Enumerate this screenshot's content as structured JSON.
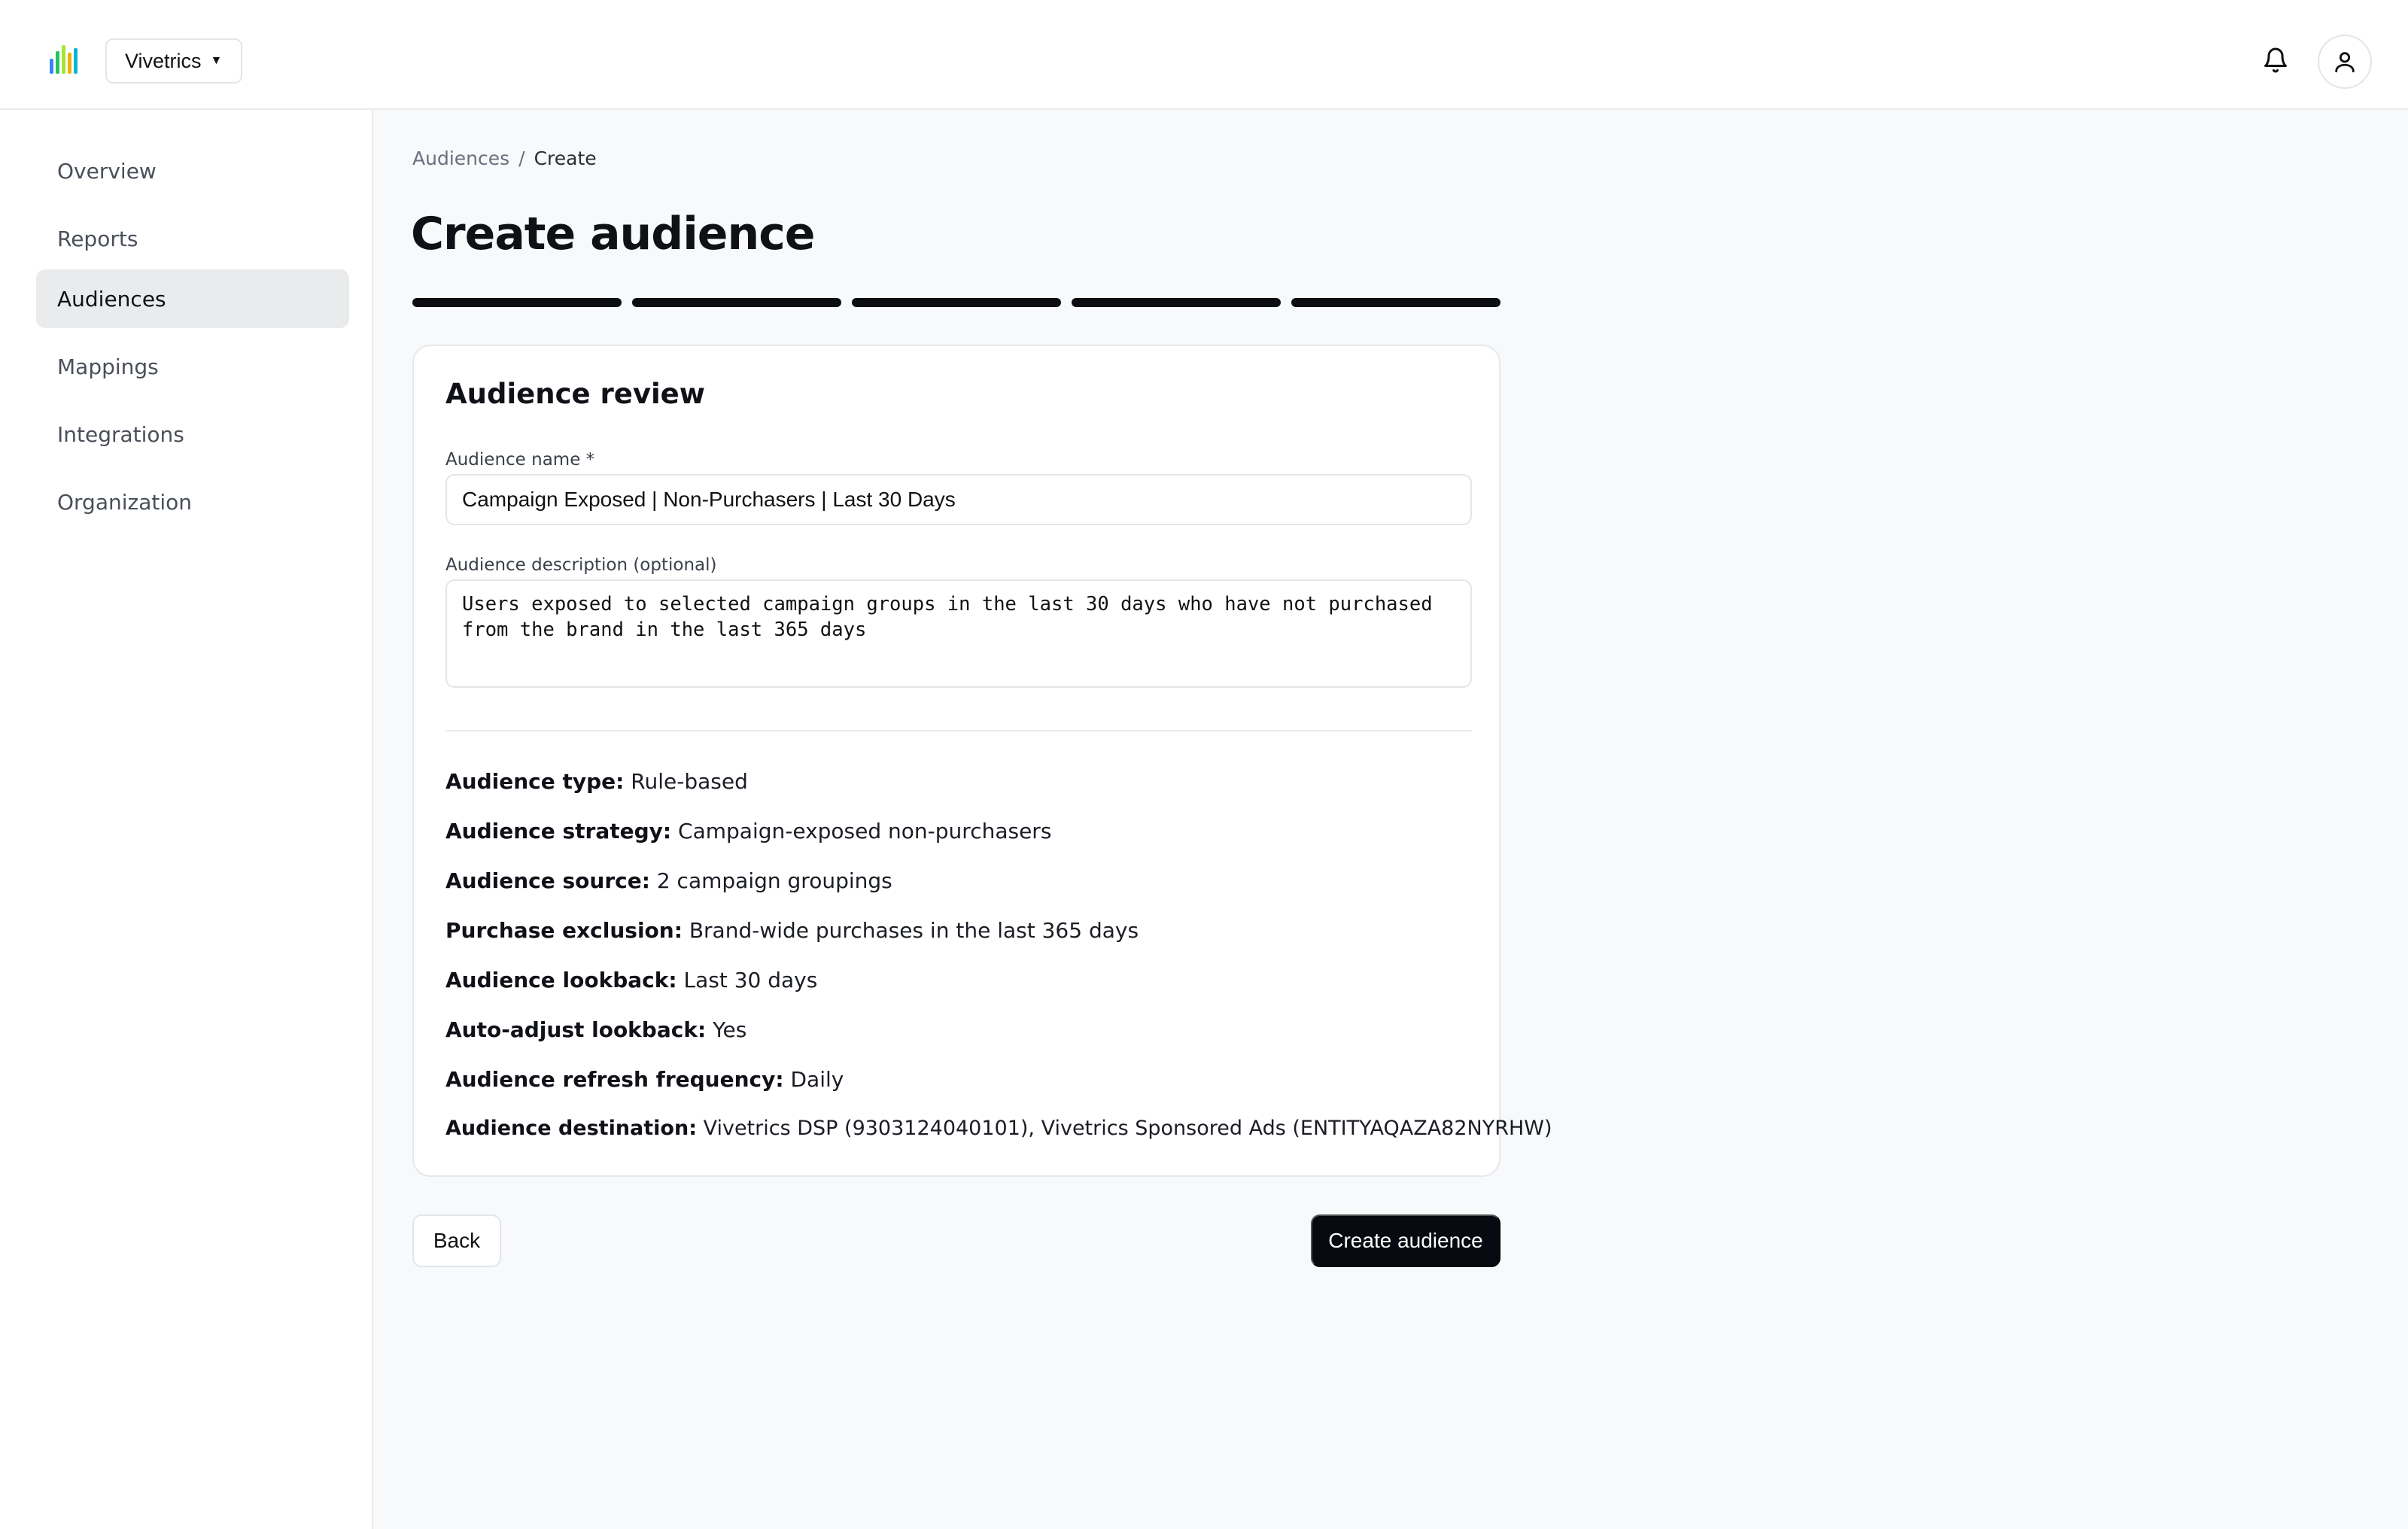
{
  "header": {
    "org_name": "Vivetrics",
    "logo_colors": [
      "#3b82f6",
      "#22c55e",
      "#a3e635",
      "#eab308",
      "#06b6d4"
    ]
  },
  "sidebar": {
    "items": [
      {
        "label": "Overview"
      },
      {
        "label": "Reports"
      },
      {
        "label": "Audiences",
        "active": true
      },
      {
        "label": "Mappings"
      },
      {
        "label": "Integrations"
      },
      {
        "label": "Organization"
      }
    ]
  },
  "breadcrumb": {
    "parent": "Audiences",
    "separator": "/",
    "current": "Create"
  },
  "page": {
    "title": "Create audience",
    "step_count": 5,
    "steps_completed": 5
  },
  "card": {
    "title": "Audience review",
    "name_label": "Audience name *",
    "name_value": "Campaign Exposed | Non-Purchasers | Last 30 Days",
    "description_label": "Audience description (optional)",
    "description_value": "Users exposed to selected campaign groups in the last 30 days who have not purchased from the brand in the last 365 days",
    "details": [
      {
        "label": "Audience type:",
        "value": "Rule-based"
      },
      {
        "label": "Audience strategy:",
        "value": "Campaign-exposed non-purchasers"
      },
      {
        "label": "Audience source:",
        "value": "2 campaign groupings"
      },
      {
        "label": "Purchase exclusion:",
        "value": "Brand-wide purchases in the last 365 days"
      },
      {
        "label": "Audience lookback:",
        "value": "Last 30 days"
      },
      {
        "label": "Auto-adjust lookback:",
        "value": "Yes"
      },
      {
        "label": "Audience refresh frequency:",
        "value": "Daily"
      },
      {
        "label": "Audience destination:",
        "value": "Vivetrics DSP (9303124040101), Vivetrics Sponsored Ads (ENTITYAQAZA82NYRHW)"
      }
    ]
  },
  "actions": {
    "back_label": "Back",
    "create_label": "Create audience"
  }
}
